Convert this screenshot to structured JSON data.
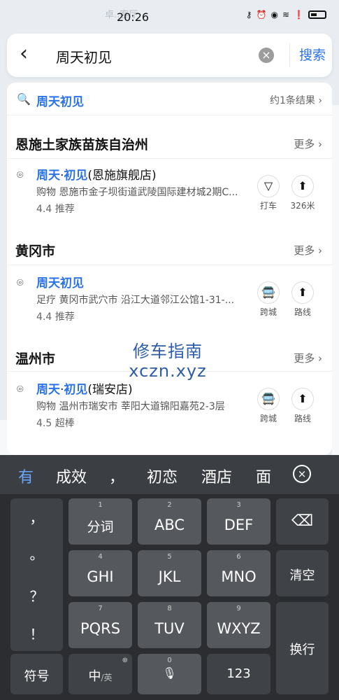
{
  "status": {
    "time": "20:26"
  },
  "map": {
    "label": "卓..客厅"
  },
  "search": {
    "query": "周天初见",
    "button": "搜索"
  },
  "suggestion": {
    "name": "周天初见",
    "count": "约1条结果"
  },
  "groups": [
    {
      "city": "恩施土家族苗族自治州",
      "more": "更多",
      "poi": {
        "title_hl1": "周天",
        "title_dot": "·",
        "title_hl2": "初见",
        "title_rest": "(恩施旗舰店)",
        "address": "购物   恩施市金子坝街道武陵国际建材城2期C...",
        "rating": "4.4  推荐",
        "action1": "打车",
        "action2": "326米"
      }
    },
    {
      "city": "黄冈市",
      "more": "更多",
      "poi": {
        "title_hl1": "周天初见",
        "title_dot": "",
        "title_hl2": "",
        "title_rest": "",
        "address": "足疗   黄冈市武穴市 沿江大道邻江公馆1-31-...",
        "rating": "4.4  推荐",
        "action1": "跨城",
        "action2": "路线"
      }
    },
    {
      "city": "温州市",
      "more": "更多",
      "poi": {
        "title_hl1": "周天",
        "title_dot": "·",
        "title_hl2": "初见",
        "title_rest": "(瑞安店)",
        "address": "购物   温州市瑞安市 莘阳大道锦阳嘉苑2-3层",
        "rating": "4.5  超棒",
        "action1": "跨城",
        "action2": "路线"
      }
    }
  ],
  "watermark": {
    "line1": "修车指南",
    "line2": "xczn.xyz"
  },
  "candidates": [
    "有",
    "成效",
    "，",
    "初恋",
    "酒店",
    "面"
  ],
  "keyboard": {
    "punct": [
      "，",
      "。",
      "？",
      "！"
    ],
    "keys": [
      {
        "num": "1",
        "label": "分词"
      },
      {
        "num": "2",
        "label": "ABC"
      },
      {
        "num": "3",
        "label": "DEF"
      },
      {
        "num": "4",
        "label": "GHI"
      },
      {
        "num": "5",
        "label": "JKL"
      },
      {
        "num": "6",
        "label": "MNO"
      },
      {
        "num": "7",
        "label": "PQRS"
      },
      {
        "num": "8",
        "label": "TUV"
      },
      {
        "num": "9",
        "label": "WXYZ"
      }
    ],
    "clear": "清空",
    "enter": "换行",
    "symbol": "符号",
    "lang_main": "中",
    "lang_sub": "/英",
    "zero": "0",
    "num_mode": "123"
  }
}
